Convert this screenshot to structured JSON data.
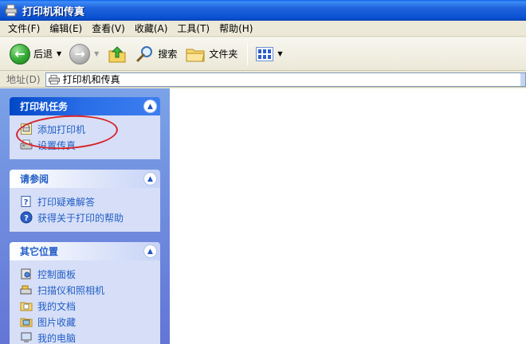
{
  "window": {
    "title": "打印机和传真"
  },
  "menu": [
    {
      "label": "文件(F)"
    },
    {
      "label": "编辑(E)"
    },
    {
      "label": "查看(V)"
    },
    {
      "label": "收藏(A)"
    },
    {
      "label": "工具(T)"
    },
    {
      "label": "帮助(H)"
    }
  ],
  "toolbar": {
    "back_label": "后退",
    "search_label": "搜索",
    "folders_label": "文件夹"
  },
  "address": {
    "label": "地址(D)",
    "value": "打印机和传真"
  },
  "panels": [
    {
      "title": "打印机任务",
      "items": [
        {
          "label": "添加打印机",
          "icon": "add-printer-icon"
        },
        {
          "label": "设置传真",
          "icon": "fax-icon"
        }
      ]
    },
    {
      "title": "请参阅",
      "items": [
        {
          "label": "打印疑难解答",
          "icon": "help-book-icon"
        },
        {
          "label": "获得关于打印的帮助",
          "icon": "help-icon"
        }
      ]
    },
    {
      "title": "其它位置",
      "items": [
        {
          "label": "控制面板",
          "icon": "control-panel-icon"
        },
        {
          "label": "扫描仪和照相机",
          "icon": "scanner-camera-icon"
        },
        {
          "label": "我的文档",
          "icon": "my-documents-icon"
        },
        {
          "label": "图片收藏",
          "icon": "my-pictures-icon"
        },
        {
          "label": "我的电脑",
          "icon": "my-computer-icon"
        }
      ]
    }
  ],
  "colors": {
    "titlebar": "#0850d0",
    "taskpane": "#6f8fdf",
    "link": "#215dc6",
    "highlight": "#d8242a"
  }
}
